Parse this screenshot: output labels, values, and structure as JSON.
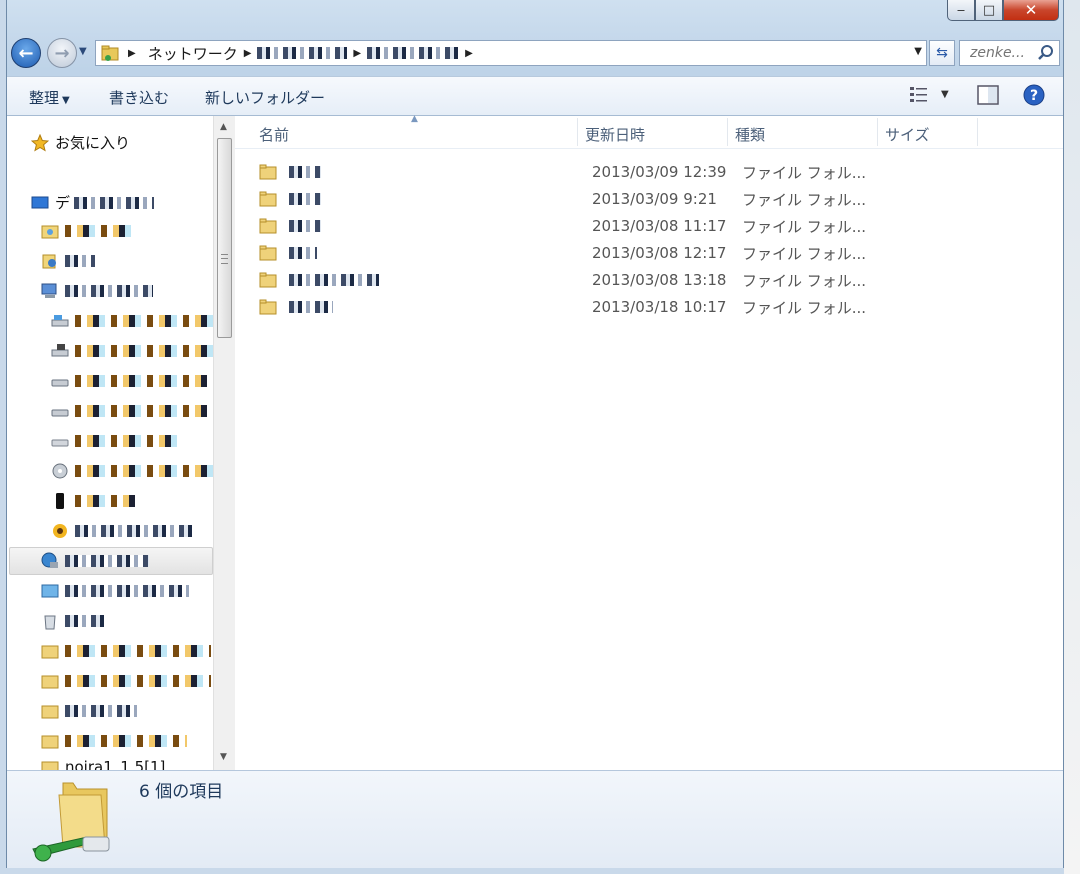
{
  "window": {
    "caption": {
      "minimize": "‒",
      "maximize": "□",
      "close": "✕"
    }
  },
  "address_bar": {
    "segments": [
      "ネットワーク"
    ],
    "search_placeholder": "zenke..."
  },
  "toolbar": {
    "organize": "整理",
    "burn": "書き込む",
    "new_folder": "新しいフォルダー"
  },
  "nav_pane": {
    "favorites": "お気に入り",
    "desktop_prefix": "デ",
    "bottom_item": "noira1_1.5[1]"
  },
  "file_list": {
    "columns": [
      "名前",
      "更新日時",
      "種類",
      "サイズ"
    ],
    "rows": [
      {
        "modified": "2013/03/09 12:39",
        "type": "ファイル フォル..."
      },
      {
        "modified": "2013/03/09 9:21",
        "type": "ファイル フォル..."
      },
      {
        "modified": "2013/03/08 11:17",
        "type": "ファイル フォル..."
      },
      {
        "modified": "2013/03/08 12:17",
        "type": "ファイル フォル..."
      },
      {
        "modified": "2013/03/08 13:18",
        "type": "ファイル フォル..."
      },
      {
        "modified": "2013/03/18 10:17",
        "type": "ファイル フォル..."
      }
    ]
  },
  "details_pane": {
    "item_count": "6 個の項目"
  }
}
